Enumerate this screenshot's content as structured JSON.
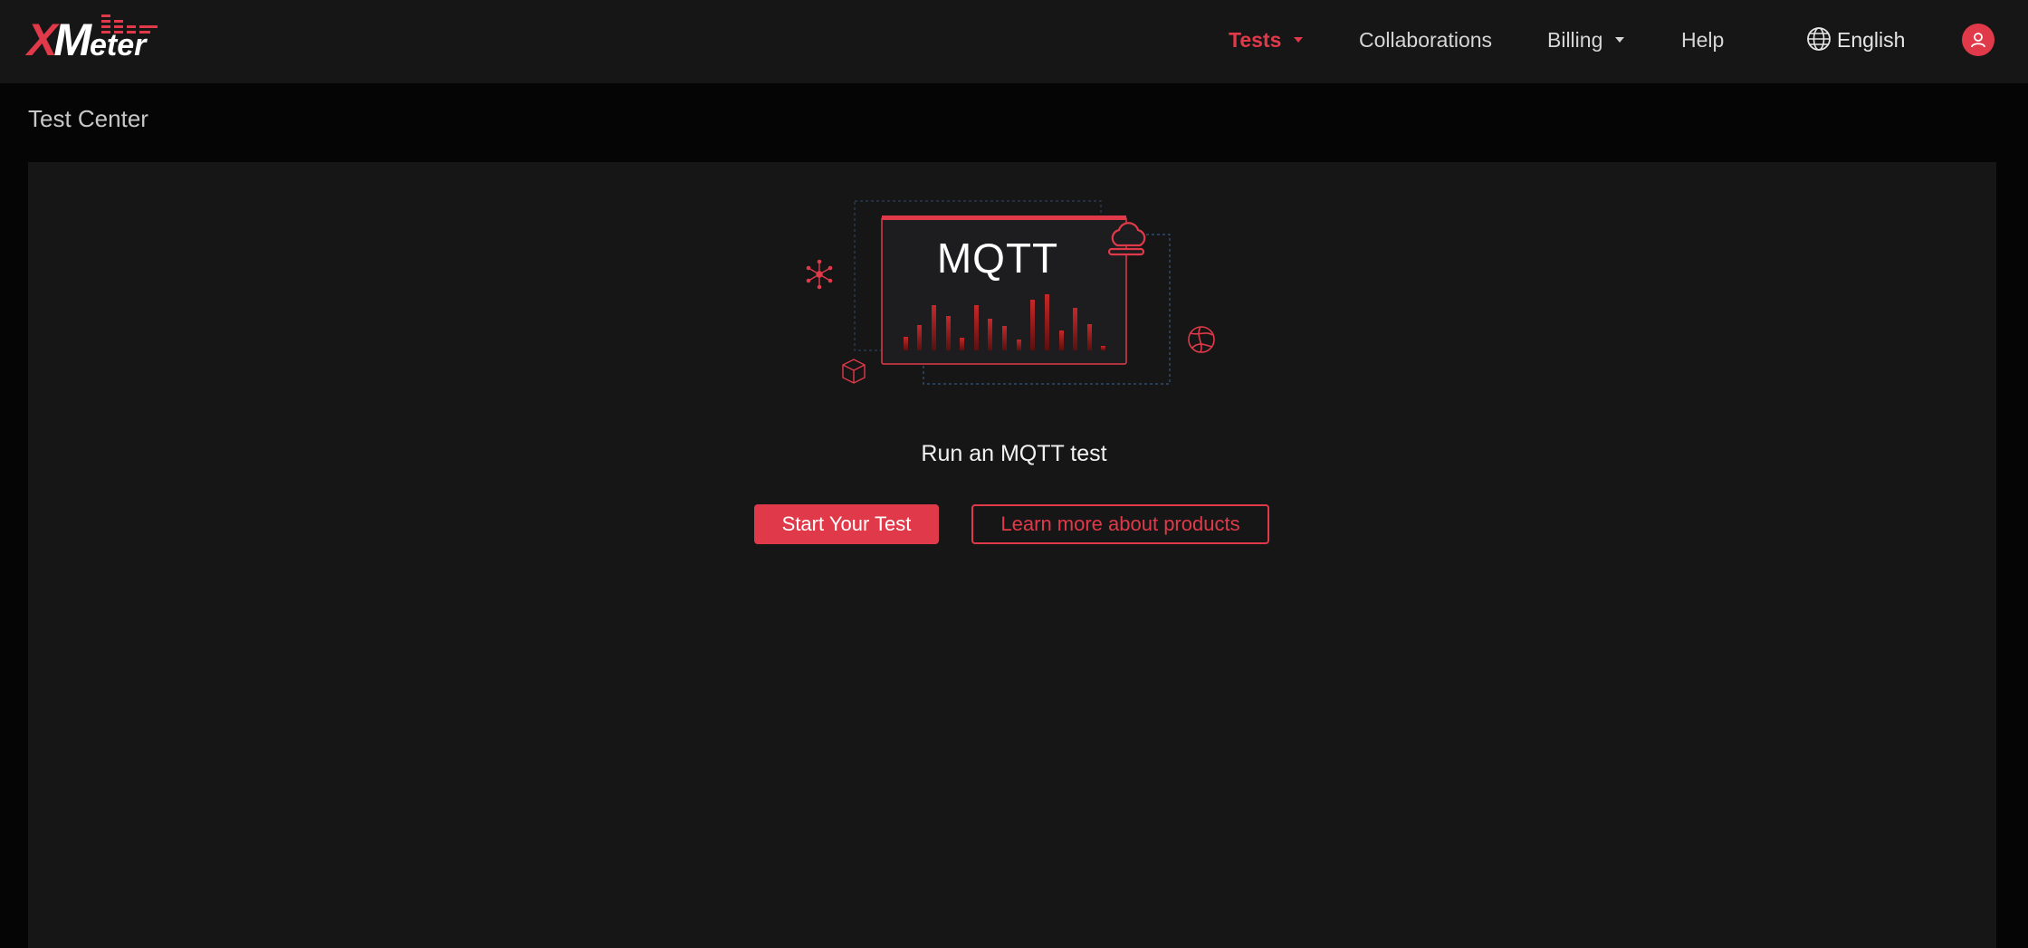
{
  "brand": {
    "logo_x": "X",
    "logo_m": "M",
    "logo_eter": "eter",
    "accent": "#e03a4a"
  },
  "nav": {
    "tests": "Tests",
    "collaborations": "Collaborations",
    "billing": "Billing",
    "help": "Help",
    "language": "English"
  },
  "page": {
    "title": "Test Center"
  },
  "empty_state": {
    "illustration_label": "MQTT",
    "headline": "Run an MQTT test",
    "primary_button": "Start Your Test",
    "secondary_button": "Learn more about products"
  },
  "icons": {
    "language": "globe-icon",
    "user": "user-icon",
    "cloud": "cloud-icon",
    "network": "network-node-icon",
    "globe": "globe-icon",
    "cube": "cube-icon"
  }
}
